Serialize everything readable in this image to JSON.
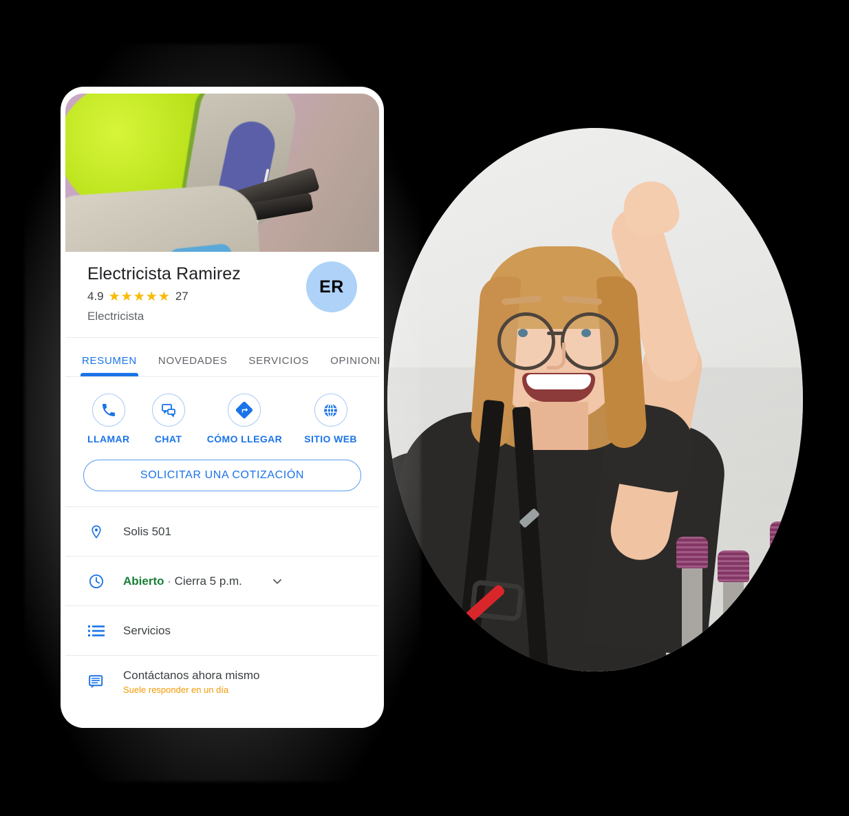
{
  "background_color": "#000000",
  "business": {
    "name": "Electricista Ramirez",
    "rating_value": "4.9",
    "rating_stars": 4.9,
    "review_count": "27",
    "category": "Electricista",
    "avatar_initials": "ER",
    "avatar_color": "#aed2f8"
  },
  "tabs": [
    {
      "label": "RESUMEN",
      "active": true
    },
    {
      "label": "NOVEDADES",
      "active": false
    },
    {
      "label": "SERVICIOS",
      "active": false
    },
    {
      "label": "OPINIONES",
      "active": false
    }
  ],
  "actions": [
    {
      "label": "LLAMAR",
      "icon": "phone-icon"
    },
    {
      "label": "CHAT",
      "icon": "chat-icon"
    },
    {
      "label": "CÓMO LLEGAR",
      "icon": "directions-icon"
    },
    {
      "label": "SITIO WEB",
      "icon": "globe-icon"
    }
  ],
  "quote_button": {
    "label": "SOLICITAR UNA COTIZACIÓN"
  },
  "info_rows": {
    "address": {
      "text": "Solis 501",
      "icon": "location-pin-icon"
    },
    "hours": {
      "status": "Abierto",
      "separator": "·",
      "closing": "Cierra 5 p.m.",
      "icon": "clock-icon",
      "chevron": "chevron-down-icon"
    },
    "services": {
      "text": "Servicios",
      "icon": "list-icon"
    },
    "contact": {
      "text": "Contáctanos ahora mismo",
      "subtext": "Suele responder en un día",
      "icon": "message-icon"
    }
  },
  "colors": {
    "accent_blue": "#1a73e8",
    "star_gold": "#fabb05",
    "open_green": "#188038",
    "response_orange": "#f29900"
  }
}
